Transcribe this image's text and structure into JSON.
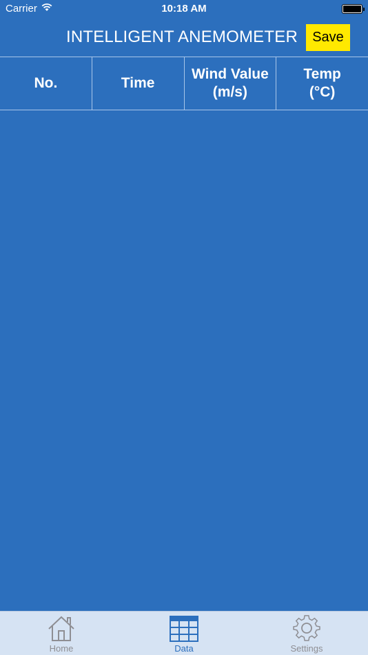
{
  "status_bar": {
    "carrier": "Carrier",
    "time": "10:18 AM"
  },
  "nav": {
    "title": "INTELLIGENT ANEMOMETER",
    "save_label": "Save"
  },
  "table": {
    "columns": [
      "No.",
      "Time",
      "Wind Value\n(m/s)",
      "Temp\n(°C)"
    ],
    "rows": []
  },
  "tabs": [
    {
      "label": "Home",
      "icon": "home-icon",
      "active": false
    },
    {
      "label": "Data",
      "icon": "grid-icon",
      "active": true
    },
    {
      "label": "Settings",
      "icon": "gear-icon",
      "active": false
    }
  ],
  "colors": {
    "background": "#2c6fbd",
    "save_button": "#ffe900",
    "tab_bar": "#d6e3f3",
    "tab_active": "#2c6fbd",
    "tab_inactive": "#8e8e93"
  }
}
